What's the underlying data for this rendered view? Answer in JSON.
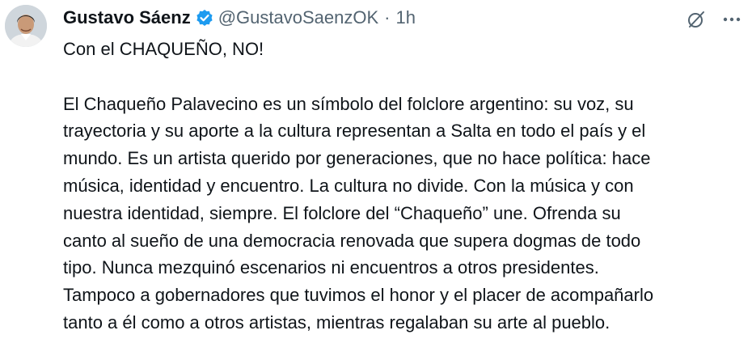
{
  "author": {
    "display_name": "Gustavo Sáenz",
    "handle": "@GustavoSaenzOK",
    "separator": "·",
    "timestamp": "1h",
    "verified": true,
    "verified_color": "#1d9bf0"
  },
  "actions": {
    "grok_icon": "grok-icon",
    "more_icon": "more-horizontal-icon"
  },
  "tweet": {
    "headline": "Con el CHAQUEÑO, NO!",
    "body_lines": [
      "El Chaqueño Palavecino es un símbolo del folclore argentino: su voz, su",
      "trayectoria y su aporte a la cultura representan a Salta en todo el país y el",
      "mundo. Es un artista querido por generaciones, que no hace política: hace",
      "música, identidad y encuentro. La cultura no divide. Con la música y con",
      "nuestra identidad, siempre. El folclore del “Chaqueño” une. Ofrenda su",
      "canto al sueño de una democracia renovada que supera dogmas de todo",
      "tipo. Nunca mezquinó escenarios ni encuentros a otros presidentes.",
      "Tampoco a gobernadores que tuvimos el honor y el placer de acompañarlo",
      "tanto a él como a otros artistas, mientras regalaban su arte al pueblo."
    ]
  },
  "colors": {
    "text_primary": "#0f1419",
    "text_secondary": "#536471"
  }
}
